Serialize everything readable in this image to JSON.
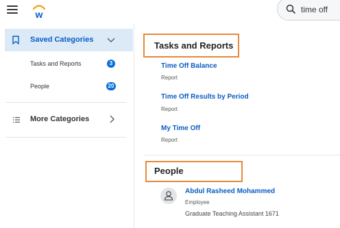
{
  "header": {
    "menu_icon": "hamburger-menu-icon",
    "logo_icon": "workday-logo-icon",
    "search_icon": "search-icon",
    "search_value": "time off"
  },
  "sidebar": {
    "saved": {
      "label": "Saved Categories",
      "icon": "bookmark-icon"
    },
    "items": [
      {
        "label": "Tasks and Reports",
        "count": "3"
      },
      {
        "label": "People",
        "count": "20"
      }
    ],
    "more": {
      "label": "More Categories",
      "icon": "list-icon"
    }
  },
  "main": {
    "tasks": {
      "title": "Tasks and Reports",
      "results": [
        {
          "name": "Time Off Balance",
          "type": "Report"
        },
        {
          "name": "Time Off Results by Period",
          "type": "Report"
        },
        {
          "name": "My Time Off",
          "type": "Report"
        }
      ]
    },
    "people": {
      "title": "People",
      "person": {
        "name": "Abdul Rasheed Mohammed",
        "role": "Employee",
        "position": "Graduate Teaching Assistant 1671"
      }
    }
  },
  "colors": {
    "accent": "#0a5cc4",
    "highlight_box": "#e8883a",
    "selected_bg": "#dceaf8",
    "badge": "#0a6fd6"
  }
}
